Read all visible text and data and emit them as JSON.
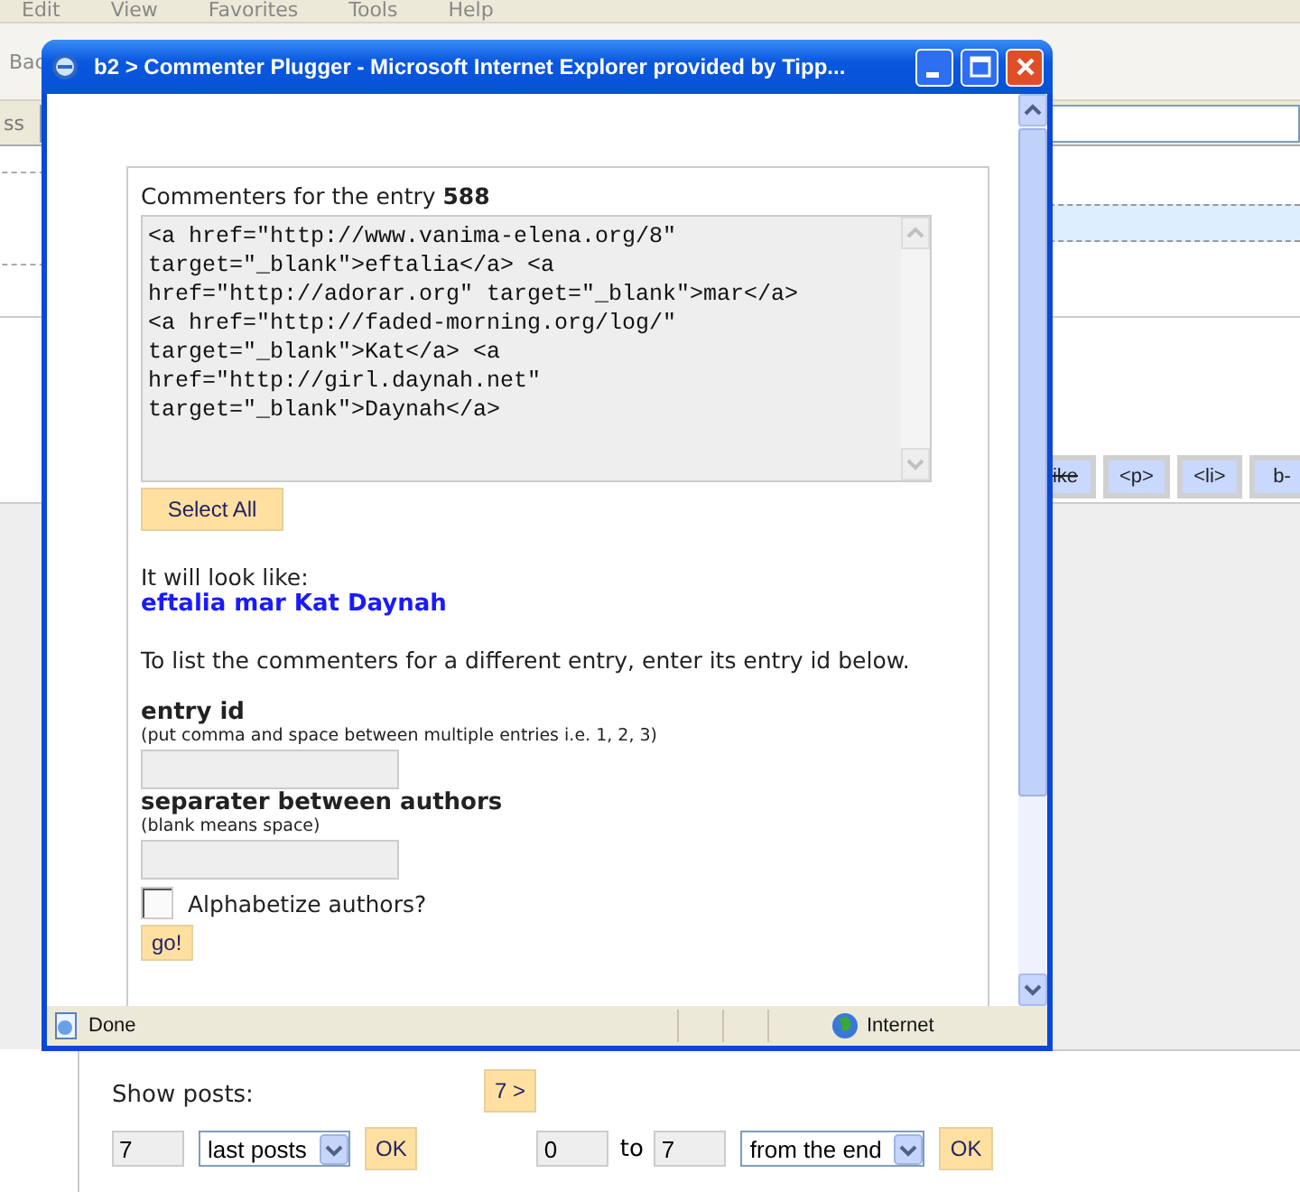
{
  "browser": {
    "menu": [
      "Edit",
      "View",
      "Favorites",
      "Tools",
      "Help"
    ],
    "back_button": "Bac",
    "address_label": "ss"
  },
  "page": {
    "format_buttons": [
      {
        "label": "ike",
        "kind": "strike"
      },
      {
        "label": "<p>",
        "kind": "plain"
      },
      {
        "label": "<li>",
        "kind": "plain"
      },
      {
        "label": "b-",
        "kind": "plain"
      }
    ],
    "show_posts": {
      "label": "Show posts:",
      "next_button": "7 >",
      "count": "7",
      "mode": "last posts",
      "ok_button": "OK",
      "from": "0",
      "to_label": "to",
      "to": "7",
      "direction": "from the end",
      "ok_button_2": "OK"
    }
  },
  "popup": {
    "title": "b2 > Commenter Plugger - Microsoft Internet Explorer provided by Tipp...",
    "heading": "Commenters for the entry **588**",
    "code_lines": [
      "<a href=\"http://www.vanima-elena.org/8\"",
      "target=\"_blank\">eftalia</a> <a",
      "href=\"http://adorar.org\" target=\"_blank\">mar</a>",
      "<a href=\"http://faded-morning.org/log/\"",
      "target=\"_blank\">Kat</a> <a",
      "href=\"http://girl.daynah.net\"",
      "target=\"_blank\">Daynah</a>"
    ],
    "select_all_button": "Select All",
    "preview_label": "It will look like:",
    "preview": "eftalia mar Kat Daynah",
    "instructions": "To list the commenters for a different entry, enter its entry id below.",
    "fields": [
      {
        "label": "entry id",
        "hint": "(put comma and space between multiple entries i.e. 1, 2, 3)"
      },
      {
        "label": "separater between authors",
        "hint": "(blank means space)"
      }
    ],
    "checkbox": {
      "label": "Alphabetize authors?",
      "checked": false
    },
    "go_button": "go!",
    "status": "Done",
    "zone": "Internet"
  }
}
